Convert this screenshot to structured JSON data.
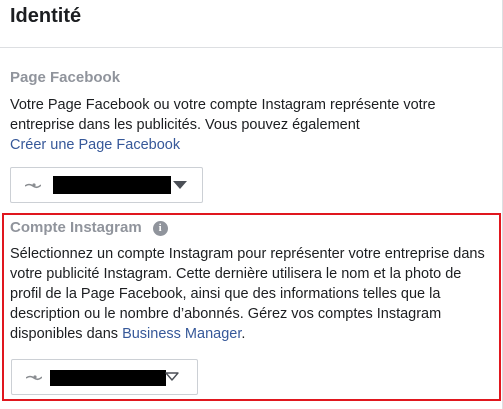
{
  "header": {
    "title": "Identité"
  },
  "facebook_page": {
    "label": "Page Facebook",
    "description": "Votre Page Facebook ou votre compte Instagram représente votre entreprise dans les publicités. Vous pouvez également",
    "create_link": "Créer une Page Facebook",
    "selector_icon": "caret-down-filled-icon"
  },
  "instagram_account": {
    "label": "Compte Instagram",
    "info_glyph": "i",
    "description": "Sélectionnez un compte Instagram pour représenter votre entreprise dans votre publicité Instagram. Cette dernière utilisera le nom et la photo de profil de la Page Facebook, ainsi que des informations telles que la description ou le nombre d’abonnés. Gérez vos comptes Instagram disponibles dans ",
    "business_manager_link": "Business Manager",
    "description_end": ".",
    "selector_icon": "caret-down-outline-icon"
  },
  "colors": {
    "highlight_border": "#e0171e",
    "link": "#365899",
    "muted_label": "#90949c"
  }
}
